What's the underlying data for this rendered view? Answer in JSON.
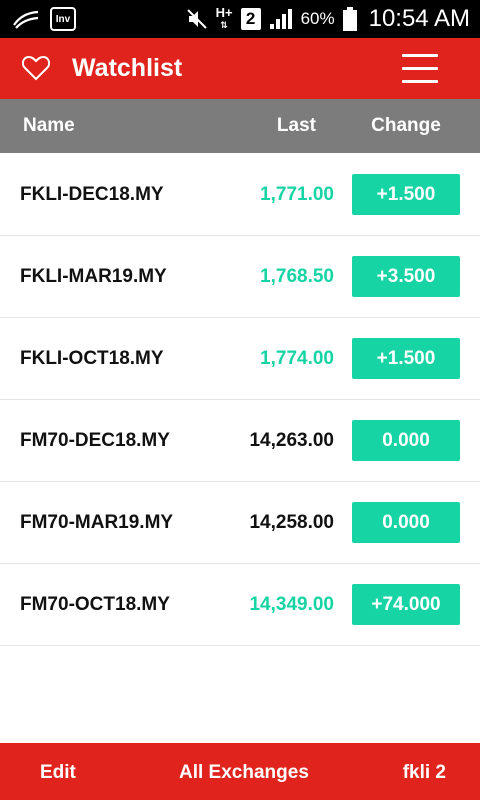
{
  "statusbar": {
    "inv_label": "Inv",
    "net_label": "H+",
    "sim_label": "2",
    "battery_pct": "60%",
    "time": "10:54 AM"
  },
  "header": {
    "title": "Watchlist",
    "accent_color": "#e0241d"
  },
  "table": {
    "columns": {
      "name": "Name",
      "last": "Last",
      "change": "Change"
    },
    "rows": [
      {
        "name": "FKLI-DEC18.MY",
        "last": "1,771.00",
        "change": "+1.500",
        "last_color": "#17d4a4"
      },
      {
        "name": "FKLI-MAR19.MY",
        "last": "1,768.50",
        "change": "+3.500",
        "last_color": "#17d4a4"
      },
      {
        "name": "FKLI-OCT18.MY",
        "last": "1,774.00",
        "change": "+1.500",
        "last_color": "#17d4a4"
      },
      {
        "name": "FM70-DEC18.MY",
        "last": "14,263.00",
        "change": "0.000",
        "last_color": "#111111"
      },
      {
        "name": "FM70-MAR19.MY",
        "last": "14,258.00",
        "change": "0.000",
        "last_color": "#111111"
      },
      {
        "name": "FM70-OCT18.MY",
        "last": "14,349.00",
        "change": "+74.000",
        "last_color": "#17d4a4"
      }
    ],
    "badge_color": "#17d4a4"
  },
  "footer": {
    "edit": "Edit",
    "all_exchanges": "All Exchanges",
    "list_name": "fkli 2"
  },
  "icons": [
    "signal-app-icon",
    "inv-icon",
    "mute-icon",
    "network-icon",
    "sim-icon",
    "signal-bars-icon",
    "battery-icon",
    "heart-icon",
    "menu-icon"
  ]
}
